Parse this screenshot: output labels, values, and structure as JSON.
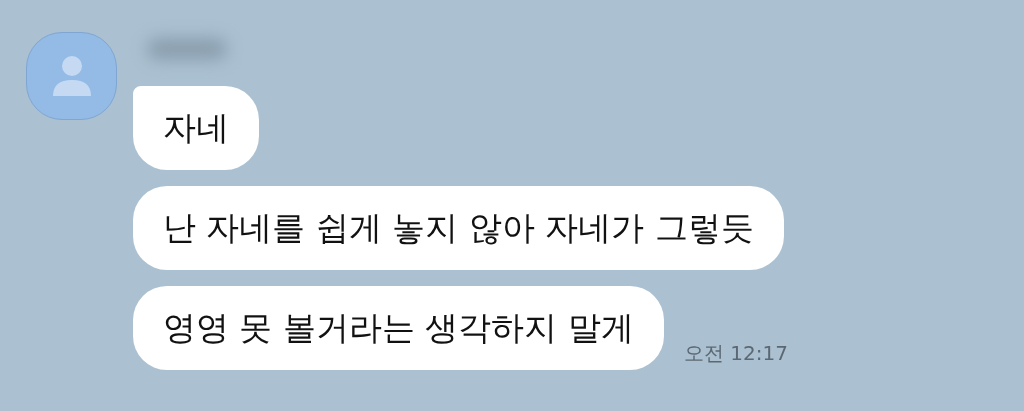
{
  "messages": [
    {
      "text": "자네"
    },
    {
      "text": "난 자네를 쉽게 놓지 않아 자네가 그렇듯"
    },
    {
      "text": "영영 못 볼거라는 생각하지 말게",
      "time": "오전 12:17"
    }
  ]
}
